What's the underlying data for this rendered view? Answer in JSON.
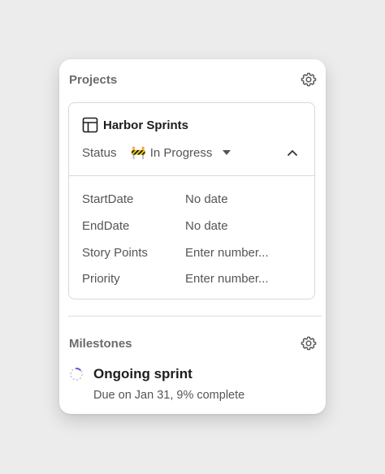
{
  "projects": {
    "title": "Projects",
    "card": {
      "name": "Harbor Sprints",
      "status_label": "Status",
      "status_value": "In Progress",
      "status_emoji": "🚧",
      "properties": [
        {
          "label": "StartDate",
          "value": "No date"
        },
        {
          "label": "EndDate",
          "value": "No date"
        },
        {
          "label": "Story Points",
          "value": "Enter number..."
        },
        {
          "label": "Priority",
          "value": "Enter number..."
        }
      ]
    }
  },
  "milestones": {
    "title": "Milestones",
    "item": {
      "name": "Ongoing sprint",
      "subtitle": "Due on Jan 31, 9% complete",
      "progress": 0.09
    }
  },
  "colors": {
    "progress_ring": "#5b5bd6",
    "ring_track": "#c8c8c8"
  },
  "icons": {
    "settings": "gear-icon",
    "table": "table-icon",
    "collapse": "chevron-up-icon",
    "dropdown": "caret-down-icon"
  }
}
